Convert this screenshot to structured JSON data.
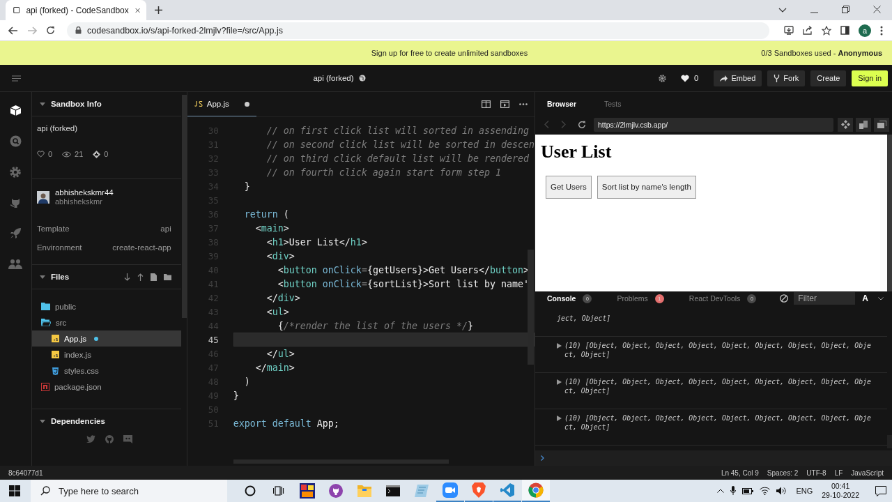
{
  "browser": {
    "tab_title": "api (forked) - CodeSandbox",
    "url": "codesandbox.io/s/api-forked-2lmjlv?file=/src/App.js",
    "profile_initial": "a"
  },
  "banner": {
    "message": "Sign up for free to create unlimited sandboxes",
    "usage": "0/3 Sandboxes used - **Anonymous**"
  },
  "header": {
    "title": "api (forked)",
    "likes": "0",
    "buttons": [
      {
        "label": "Embed",
        "kind": "embed"
      },
      {
        "label": "Fork",
        "kind": "fork"
      },
      {
        "label": "Create",
        "kind": "create"
      },
      {
        "label": "Sign in",
        "kind": "signin"
      }
    ]
  },
  "activity_bar": [
    {
      "kind": "sandbox",
      "selected": true
    },
    {
      "kind": "search",
      "selected": false
    },
    {
      "kind": "settings",
      "selected": false
    },
    {
      "kind": "github",
      "selected": false
    },
    {
      "kind": "deploy",
      "selected": false
    },
    {
      "kind": "live",
      "selected": false
    }
  ],
  "sidebar": {
    "sandbox_info": {
      "title": "Sandbox Info",
      "expanded": true,
      "name": "api (forked)",
      "likes": "0",
      "views": "21",
      "forks": "0",
      "author": "abhishekskmr44",
      "username": "abhishekskmr",
      "properties": [
        {
          "label": "Template",
          "value": "api"
        },
        {
          "label": "Environment",
          "value": "create-react-app"
        }
      ]
    },
    "files": {
      "title": "Files",
      "expanded": true,
      "tree": [
        {
          "name": "public",
          "kind": "folder",
          "expanded": false,
          "selected": false
        },
        {
          "name": "src",
          "kind": "folder",
          "expanded": true,
          "selected": false,
          "children": [
            {
              "name": "App.js",
              "kind": "js",
              "selected": true,
              "modified": true
            },
            {
              "name": "index.js",
              "kind": "js",
              "selected": false,
              "modified": false
            },
            {
              "name": "styles.css",
              "kind": "css",
              "selected": false,
              "modified": false
            }
          ]
        },
        {
          "name": "package.json",
          "kind": "npm",
          "selected": false
        }
      ]
    },
    "dependencies": {
      "title": "Dependencies",
      "expanded": true
    }
  },
  "editor": {
    "tab": {
      "name": "App.js",
      "modified": true
    },
    "lines": [
      {
        "number": "30",
        "current": false,
        "tokens": [
          {
            "kind": "comment",
            "text": "      // on first click list will sorted in assending"
          }
        ]
      },
      {
        "number": "31",
        "current": false,
        "tokens": [
          {
            "kind": "comment",
            "text": "      // on second click list will be sorted in descen"
          }
        ]
      },
      {
        "number": "32",
        "current": false,
        "tokens": [
          {
            "kind": "comment",
            "text": "      // on third click default list will be rendered"
          }
        ]
      },
      {
        "number": "33",
        "current": false,
        "tokens": [
          {
            "kind": "comment",
            "text": "      // on fourth click again start form step 1"
          }
        ]
      },
      {
        "number": "34",
        "current": false,
        "tokens": [
          {
            "kind": "plain",
            "text": "  }"
          }
        ]
      },
      {
        "number": "35",
        "current": false
      },
      {
        "number": "36",
        "current": false,
        "tokens": [
          {
            "kind": "keyword",
            "text": "  return"
          },
          {
            "kind": "plain",
            "text": " ("
          }
        ]
      },
      {
        "number": "37",
        "current": false,
        "tokens": [
          {
            "kind": "plain",
            "text": "    <"
          },
          {
            "kind": "tag",
            "text": "main"
          },
          {
            "kind": "plain",
            "text": ">"
          }
        ]
      },
      {
        "number": "38",
        "current": false,
        "tokens": [
          {
            "kind": "plain",
            "text": "      <"
          },
          {
            "kind": "tag",
            "text": "h1"
          },
          {
            "kind": "plain",
            "text": ">User List</"
          },
          {
            "kind": "tag",
            "text": "h1"
          },
          {
            "kind": "plain",
            "text": ">"
          }
        ]
      },
      {
        "number": "39",
        "current": false,
        "tokens": [
          {
            "kind": "plain",
            "text": "      <"
          },
          {
            "kind": "tag",
            "text": "div"
          },
          {
            "kind": "plain",
            "text": ">"
          }
        ]
      },
      {
        "number": "40",
        "current": false,
        "tokens": [
          {
            "kind": "plain",
            "text": "        <"
          },
          {
            "kind": "tag",
            "text": "button"
          },
          {
            "kind": "attr",
            "text": " onClick"
          },
          {
            "kind": "operator",
            "text": "="
          },
          {
            "kind": "plain",
            "text": "{getUsers}>Get Users</"
          },
          {
            "kind": "tag",
            "text": "button"
          },
          {
            "kind": "plain",
            "text": ">"
          }
        ]
      },
      {
        "number": "41",
        "current": false,
        "tokens": [
          {
            "kind": "plain",
            "text": "        <"
          },
          {
            "kind": "tag",
            "text": "button"
          },
          {
            "kind": "attr",
            "text": " onClick"
          },
          {
            "kind": "operator",
            "text": "="
          },
          {
            "kind": "plain",
            "text": "{sortList}>Sort list by name'"
          }
        ]
      },
      {
        "number": "42",
        "current": false,
        "tokens": [
          {
            "kind": "plain",
            "text": "      </"
          },
          {
            "kind": "tag",
            "text": "div"
          },
          {
            "kind": "plain",
            "text": ">"
          }
        ]
      },
      {
        "number": "43",
        "current": false,
        "tokens": [
          {
            "kind": "plain",
            "text": "      <"
          },
          {
            "kind": "tag",
            "text": "ul"
          },
          {
            "kind": "plain",
            "text": ">"
          }
        ]
      },
      {
        "number": "44",
        "current": false,
        "tokens": [
          {
            "kind": "plain",
            "text": "        {"
          },
          {
            "kind": "comment",
            "text": "/*render the list of the users */"
          },
          {
            "kind": "plain",
            "text": "}"
          }
        ]
      },
      {
        "number": "45",
        "current": true
      },
      {
        "number": "46",
        "current": false,
        "tokens": [
          {
            "kind": "plain",
            "text": "      </"
          },
          {
            "kind": "tag",
            "text": "ul"
          },
          {
            "kind": "plain",
            "text": ">"
          }
        ]
      },
      {
        "number": "47",
        "current": false,
        "tokens": [
          {
            "kind": "plain",
            "text": "    </"
          },
          {
            "kind": "tag",
            "text": "main"
          },
          {
            "kind": "plain",
            "text": ">"
          }
        ]
      },
      {
        "number": "48",
        "current": false,
        "tokens": [
          {
            "kind": "plain",
            "text": "  )"
          }
        ]
      },
      {
        "number": "49",
        "current": false,
        "tokens": [
          {
            "kind": "plain",
            "text": "}"
          }
        ]
      },
      {
        "number": "50",
        "current": false
      },
      {
        "number": "51",
        "current": false,
        "tokens": [
          {
            "kind": "keyword",
            "text": "export default"
          },
          {
            "kind": "plain",
            "text": " App;"
          }
        ]
      }
    ]
  },
  "preview": {
    "tabs": [
      {
        "label": "Browser",
        "selected": true
      },
      {
        "label": "Tests",
        "selected": false
      }
    ],
    "url": "https://2lmjlv.csb.app/",
    "page": {
      "heading": "User List",
      "buttons": [
        "Get Users",
        "Sort list by name's length"
      ]
    },
    "devtools": {
      "tabs": [
        {
          "label": "Console",
          "count": "0",
          "selected": true,
          "color": "#4a4a4a"
        },
        {
          "label": "Problems",
          "count": "1",
          "selected": false,
          "color": "#e5706f"
        },
        {
          "label": "React DevTools",
          "count": "0",
          "selected": false,
          "color": "#4a4a4a"
        }
      ],
      "filter_placeholder": "Filter",
      "font_toggle": "A",
      "messages": [
        {
          "text": "ject, Object]",
          "expandable": false
        },
        {
          "expandable": true,
          "text": "(10) [Object, Object, Object, Object, Object, Object, Object, Object, Object, Object]"
        },
        {
          "expandable": true,
          "text": "(10) [Object, Object, Object, Object, Object, Object, Object, Object, Object, Object]"
        },
        {
          "expandable": true,
          "text": "(10) [Object, Object, Object, Object, Object, Object, Object, Object, Object, Object]"
        }
      ]
    }
  },
  "status_bar": {
    "commit": "8c64077d1",
    "items": [
      "Ln 45, Col 9",
      "Spaces: 2",
      "UTF-8",
      "LF",
      "JavaScript"
    ]
  },
  "taskbar": {
    "search_placeholder": "Type here to search",
    "apps": [
      {
        "kind": "cortana",
        "running": false,
        "selected": false
      },
      {
        "kind": "taskview",
        "running": false,
        "selected": false
      },
      {
        "kind": "game",
        "running": false,
        "selected": false
      },
      {
        "kind": "github",
        "running": false,
        "selected": false
      },
      {
        "kind": "explorer",
        "running": false,
        "selected": false
      },
      {
        "kind": "terminal",
        "running": false,
        "selected": false
      },
      {
        "kind": "notes",
        "running": false,
        "selected": false
      },
      {
        "kind": "zoom",
        "running": true,
        "selected": false
      },
      {
        "kind": "brave",
        "running": true,
        "selected": false
      },
      {
        "kind": "vscode",
        "running": true,
        "selected": false
      },
      {
        "kind": "chrome",
        "running": true,
        "selected": true
      }
    ],
    "language": "ENG",
    "time": "00:41",
    "date": "29-10-2022"
  }
}
